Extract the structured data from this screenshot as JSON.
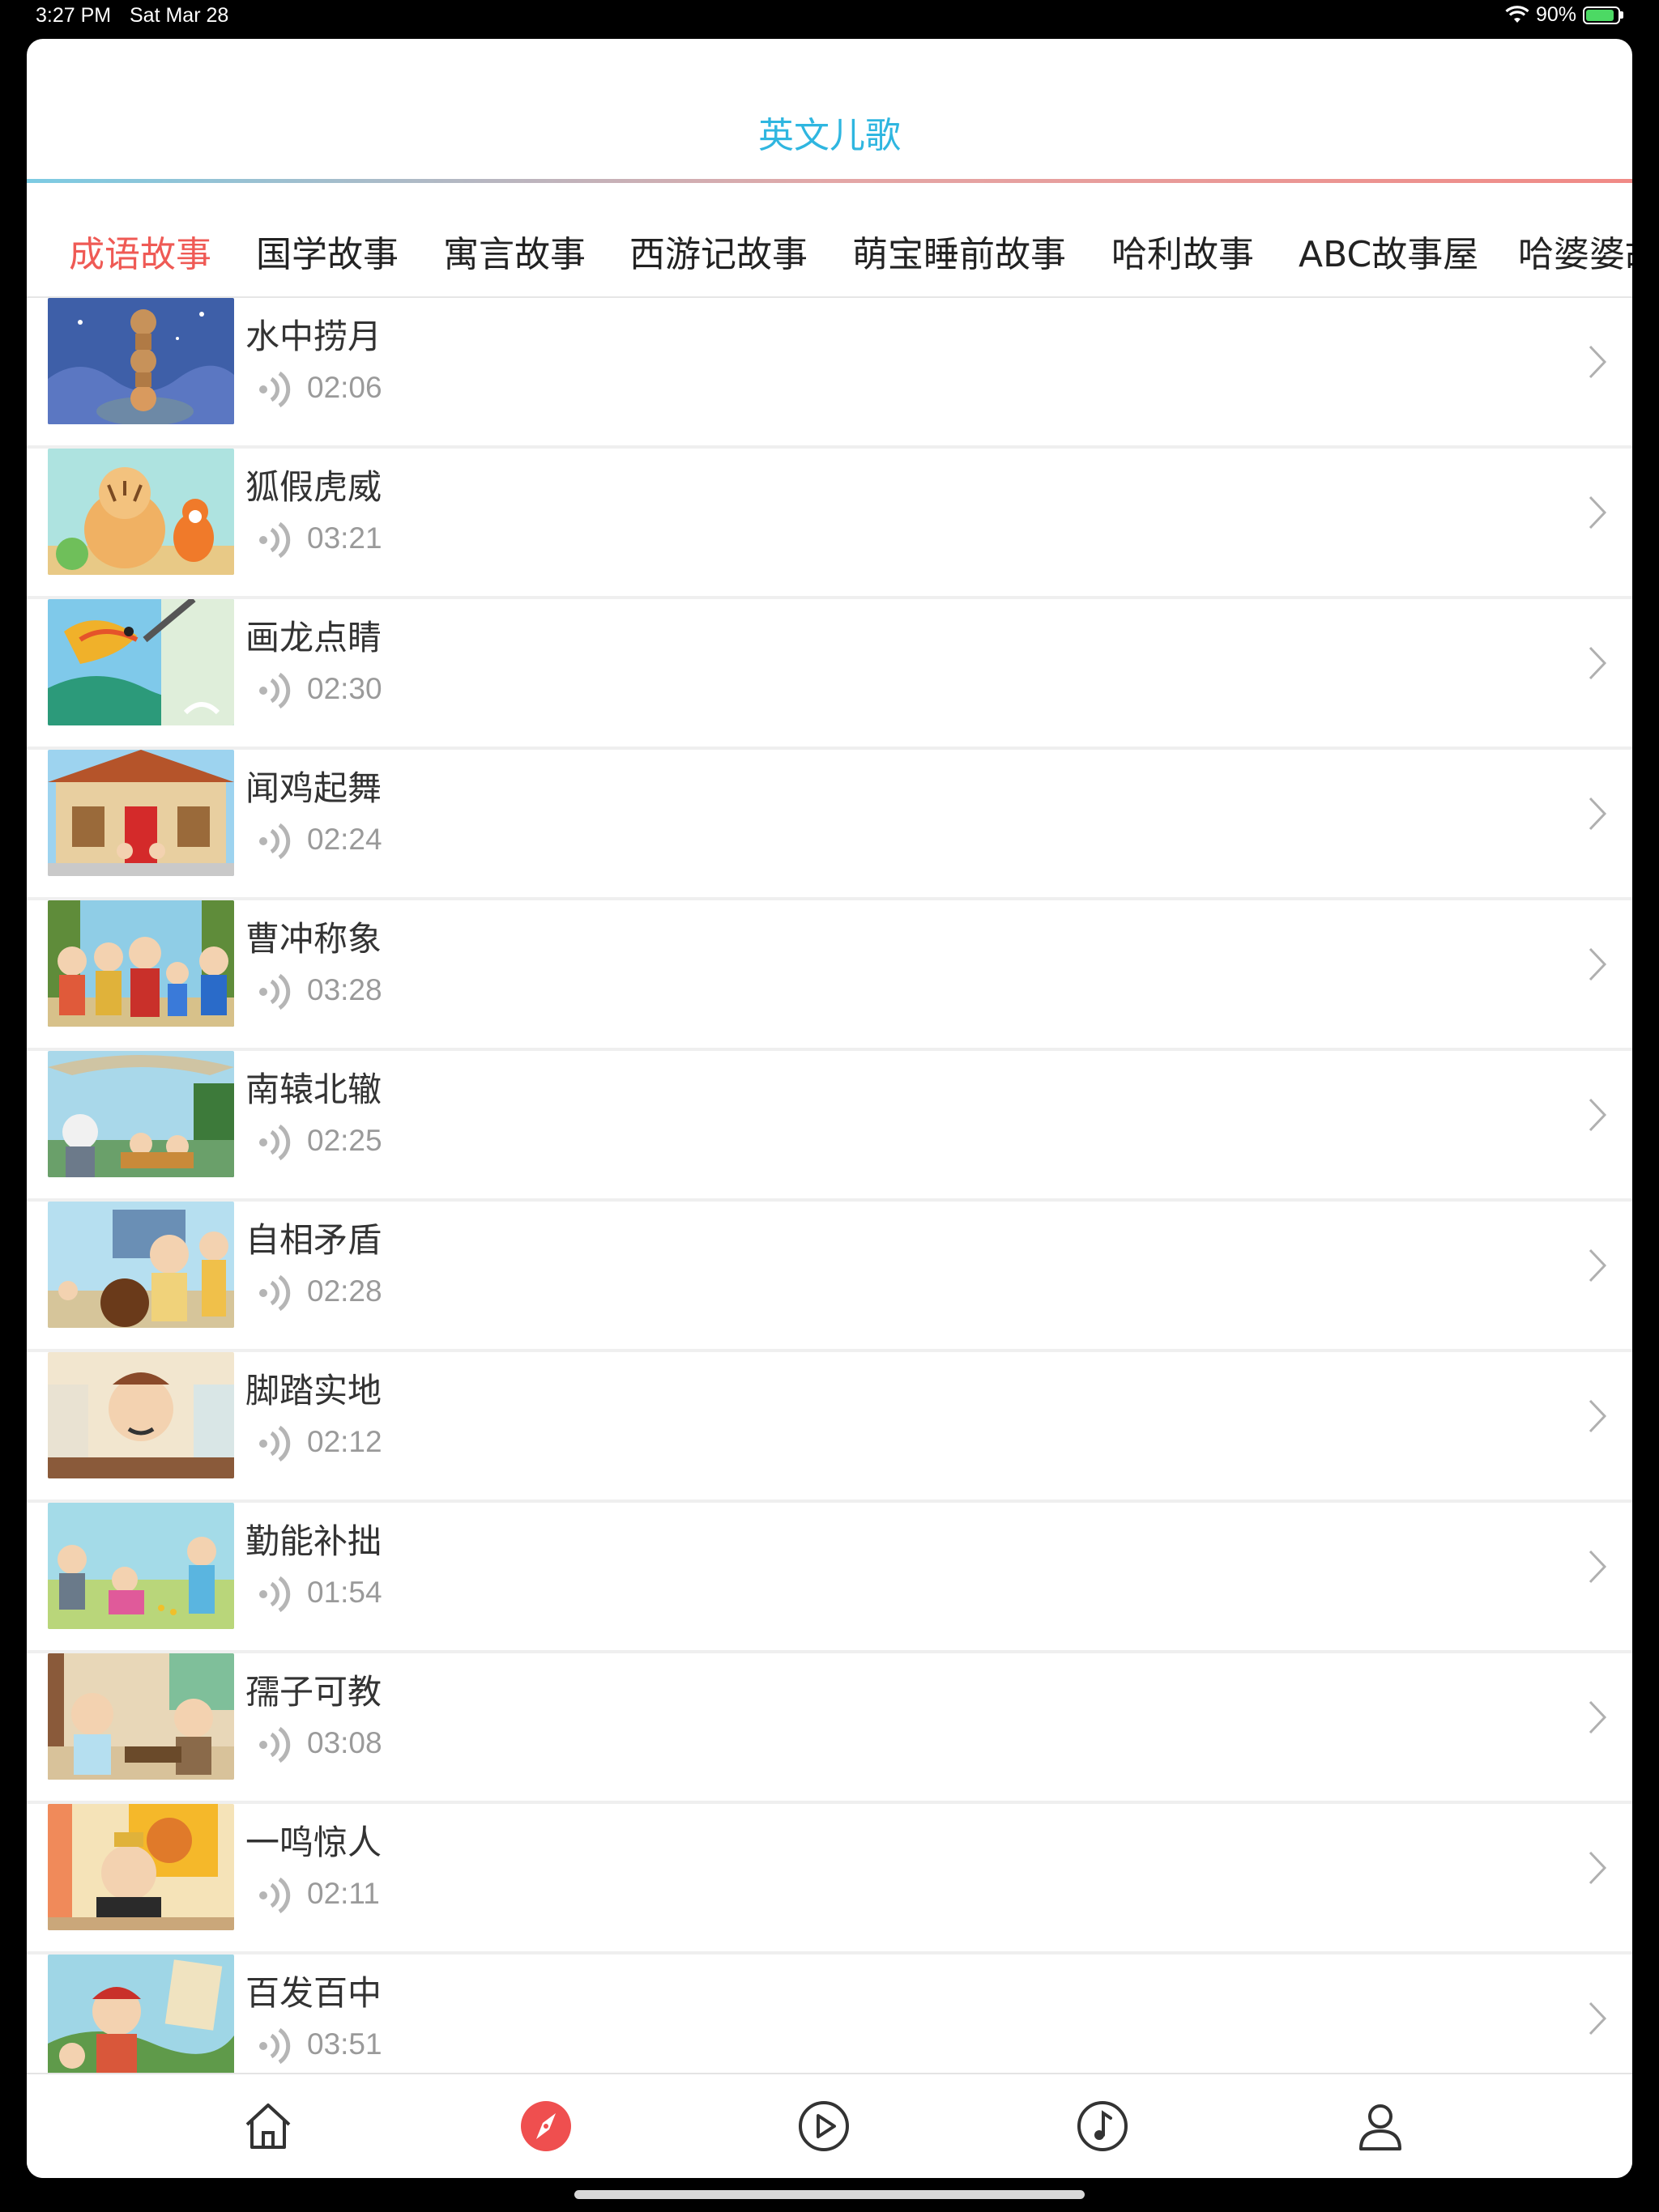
{
  "status_bar": {
    "time": "3:27 PM",
    "date": "Sat Mar 28",
    "battery": "90%"
  },
  "header": {
    "title": "英文儿歌"
  },
  "category_tabs": [
    {
      "label": "成语故事",
      "active": true
    },
    {
      "label": "国学故事",
      "active": false
    },
    {
      "label": "寓言故事",
      "active": false
    },
    {
      "label": "西游记故事",
      "active": false
    },
    {
      "label": "萌宝睡前故事",
      "active": false
    },
    {
      "label": "哈利故事",
      "active": false
    },
    {
      "label": "ABC故事屋",
      "active": false
    },
    {
      "label": "哈婆婆故事",
      "active": false
    }
  ],
  "stories": [
    {
      "title": "水中捞月",
      "duration": "02:06",
      "thumb": "night-monkeys"
    },
    {
      "title": "狐假虎威",
      "duration": "03:21",
      "thumb": "tiger-fox"
    },
    {
      "title": "画龙点睛",
      "duration": "02:30",
      "thumb": "dragon"
    },
    {
      "title": "闻鸡起舞",
      "duration": "02:24",
      "thumb": "temple"
    },
    {
      "title": "曹冲称象",
      "duration": "03:28",
      "thumb": "crowd-forest"
    },
    {
      "title": "南辕北辙",
      "duration": "02:25",
      "thumb": "cart-road"
    },
    {
      "title": "自相矛盾",
      "duration": "02:28",
      "thumb": "market"
    },
    {
      "title": "脚踏实地",
      "duration": "02:12",
      "thumb": "scholar-desk"
    },
    {
      "title": "勤能补拙",
      "duration": "01:54",
      "thumb": "village-kneel"
    },
    {
      "title": "孺子可教",
      "duration": "03:08",
      "thumb": "elder-youth"
    },
    {
      "title": "一鸣惊人",
      "duration": "02:11",
      "thumb": "king-throne"
    },
    {
      "title": "百发百中",
      "duration": "03:51",
      "thumb": "archer-banner"
    }
  ],
  "bottom_nav": [
    {
      "icon": "home-icon",
      "active": false
    },
    {
      "icon": "compass-icon",
      "active": true
    },
    {
      "icon": "play-icon",
      "active": false
    },
    {
      "icon": "music-icon",
      "active": false
    },
    {
      "icon": "profile-icon",
      "active": false
    }
  ],
  "colors": {
    "title_blue": "#2fb6e0",
    "active_tab_red": "#ef5a55",
    "active_nav_red": "#ef4f4f"
  }
}
